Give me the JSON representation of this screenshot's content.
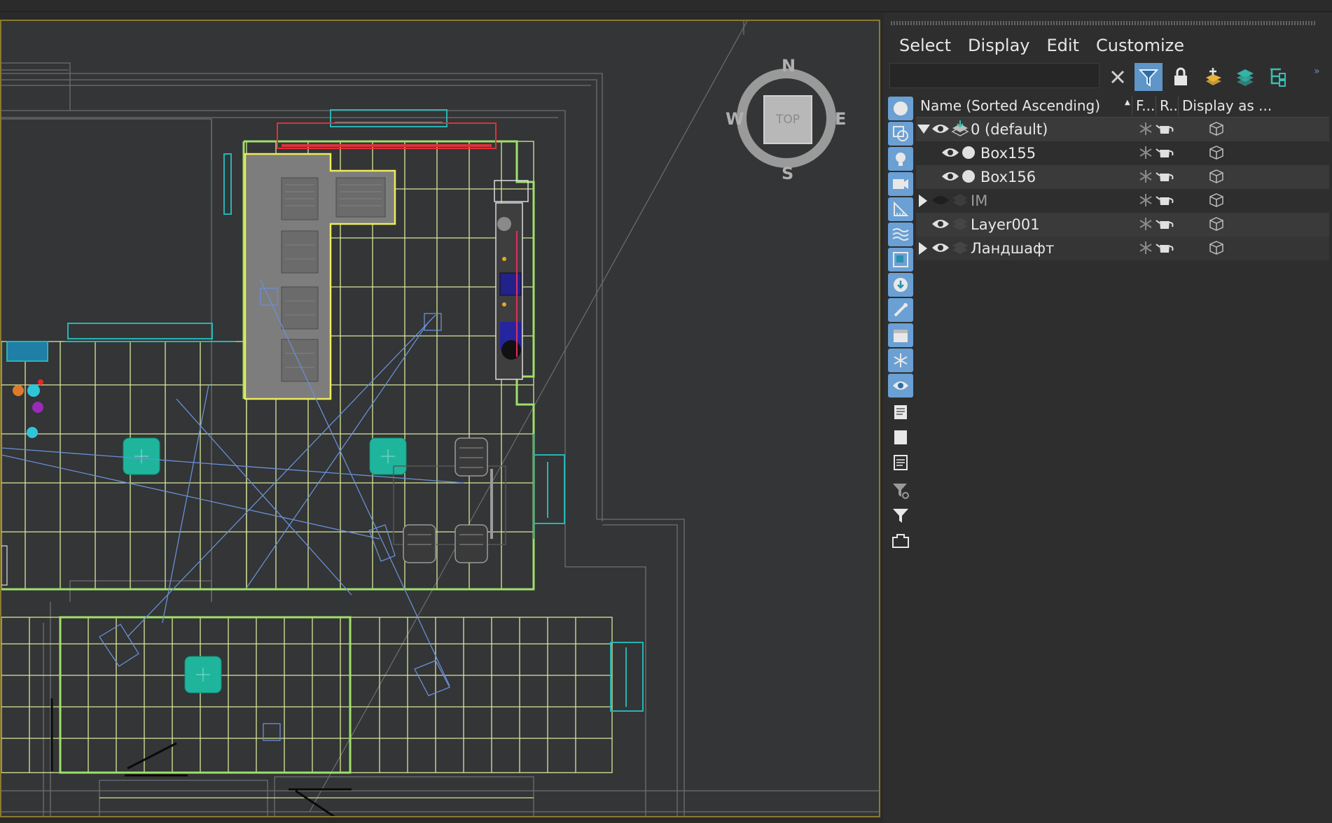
{
  "viewcube": {
    "face": "TOP",
    "north": "N",
    "south": "S",
    "east": "E",
    "west": "W"
  },
  "menu": [
    "Select",
    "Display",
    "Edit",
    "Customize"
  ],
  "search": {
    "value": "",
    "placeholder": ""
  },
  "toolbar_icons": [
    "clear-x-icon",
    "filter-icon",
    "lock-icon",
    "add-layer-icon",
    "layer-stack-icon",
    "hierarchy-icon"
  ],
  "sidebar_icons": [
    "sphere-icon",
    "shapes-icon",
    "light-icon",
    "camera-icon",
    "helper-icon",
    "spacewarp-icon",
    "group-icon",
    "xref-icon",
    "bone-icon",
    "container-icon",
    "frozen-icon",
    "hidden-icon",
    "list-icon",
    "square-icon",
    "list2-icon",
    "filter-settings-icon",
    "filter-icon",
    "tray-icon"
  ],
  "columns": {
    "name": "Name (Sorted Ascending)",
    "frozen": "F...",
    "render": "R...",
    "display": "Display as ..."
  },
  "rows": [
    {
      "name": "0 (default)",
      "level": 0,
      "expander": "open",
      "type": "layer-active",
      "visible": true,
      "dim": false
    },
    {
      "name": "Box155",
      "level": 1,
      "expander": "none",
      "type": "object",
      "visible": true,
      "dim": false
    },
    {
      "name": "Box156",
      "level": 1,
      "expander": "none",
      "type": "object",
      "visible": true,
      "dim": false
    },
    {
      "name": "IM",
      "level": 0,
      "expander": "closed",
      "type": "layer",
      "visible": false,
      "dim": true
    },
    {
      "name": "Layer001",
      "level": 0,
      "expander": "none",
      "type": "layer",
      "visible": true,
      "dim": false
    },
    {
      "name": "Ландшафт",
      "level": 0,
      "expander": "closed",
      "type": "layer",
      "visible": true,
      "dim": false
    }
  ],
  "colors": {
    "accent": "#5f95c7",
    "grid": "#d8e89a",
    "selected": "#ecec5a",
    "wall": "#9fe06a",
    "cyan": "#2ab3b3",
    "teal_object": "#1fb59c"
  }
}
